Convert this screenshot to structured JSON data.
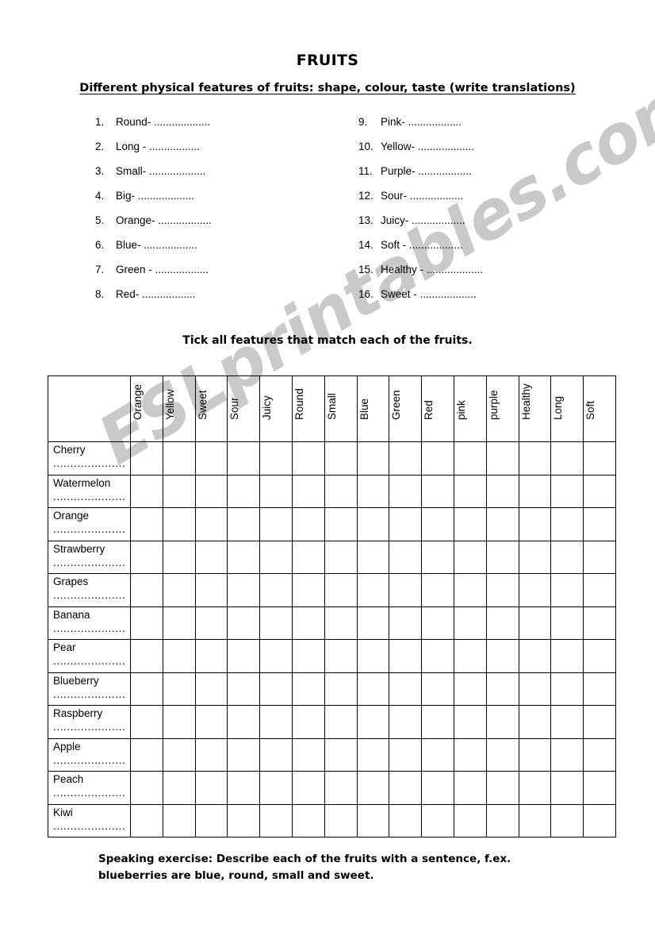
{
  "page": {
    "title": "FRUITS",
    "subtitle": "Different physical features of fruits: shape, colour, taste (write translations)",
    "tick_instruction": "Tick all features that match each of the fruits.",
    "footer": "Speaking exercise: Describe each of the fruits with a sentence, f.ex. blueberries are blue, round, small and sweet.",
    "watermark": "ESLprintables.com",
    "watermark_color": "#c9c9c9",
    "background_color": "#ffffff",
    "text_color": "#000000",
    "border_color": "#000000"
  },
  "features": {
    "left_column": [
      {
        "num": "1.",
        "text": "Round- ..................."
      },
      {
        "num": "2.",
        "text": "Long - ................."
      },
      {
        "num": "3.",
        "text": "Small- ..................."
      },
      {
        "num": "4.",
        "text": "Big- ..................."
      },
      {
        "num": "5.",
        "text": "Orange- .................."
      },
      {
        "num": "6.",
        "text": "Blue- .................."
      },
      {
        "num": "7.",
        "text": "Green - .................."
      },
      {
        "num": "8.",
        "text": "Red- .................."
      }
    ],
    "right_column": [
      {
        "num": "9.",
        "text": "Pink- .................."
      },
      {
        "num": "10.",
        "text": "Yellow- ..................."
      },
      {
        "num": "11.",
        "text": "Purple- .................."
      },
      {
        "num": "12.",
        "text": "Sour- .................."
      },
      {
        "num": "13.",
        "text": "Juicy- .................."
      },
      {
        "num": "14.",
        "text": "Soft - .................."
      },
      {
        "num": "15.",
        "text": "Healthy - ..................."
      },
      {
        "num": "16.",
        "text": "Sweet - ..................."
      }
    ]
  },
  "grid": {
    "corner_label": "",
    "feature_columns": [
      "Orange",
      "Yellow",
      "Sweet",
      "Sour",
      "Juicy",
      "Round",
      "Small",
      "Blue",
      "Green",
      "Red",
      "pink",
      "purple",
      "Healthy",
      "Long",
      "Soft"
    ],
    "dots": ".....................",
    "fruit_rows": [
      {
        "name": "Cherry"
      },
      {
        "name": "Watermelon"
      },
      {
        "name": "Orange"
      },
      {
        "name": "Strawberry"
      },
      {
        "name": "Grapes"
      },
      {
        "name": "Banana"
      },
      {
        "name": "Pear"
      },
      {
        "name": "Blueberry"
      },
      {
        "name": "Raspberry"
      },
      {
        "name": "Apple"
      },
      {
        "name": "Peach"
      },
      {
        "name": "Kiwi"
      }
    ]
  }
}
